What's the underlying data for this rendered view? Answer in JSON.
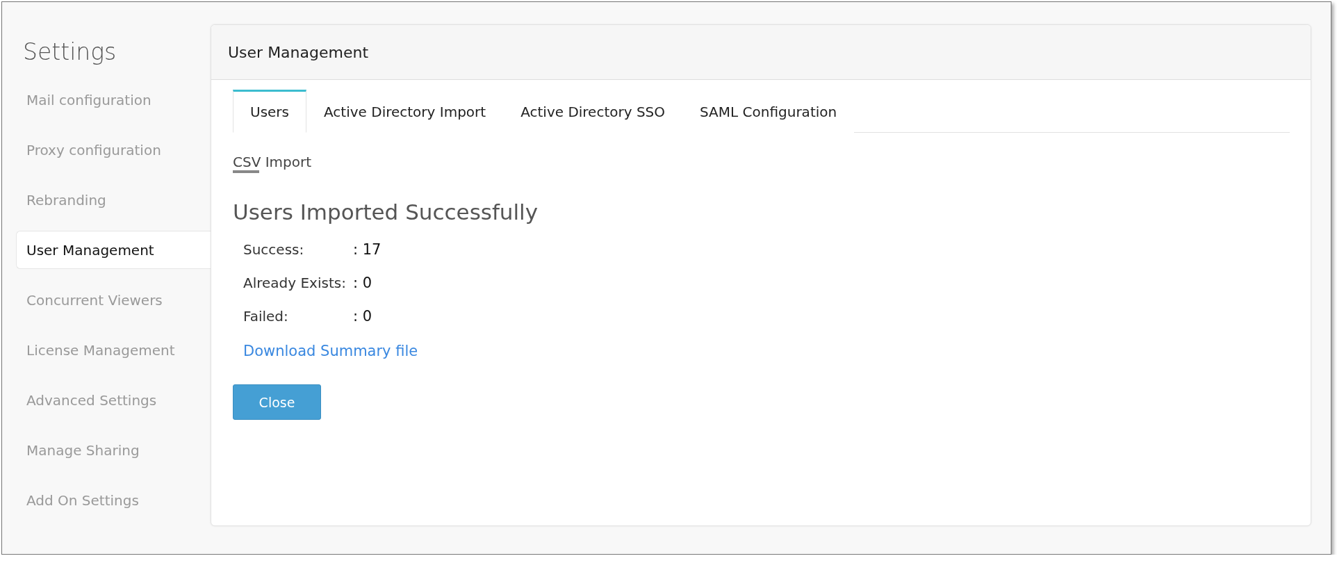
{
  "sidebar": {
    "title": "Settings",
    "items": [
      {
        "label": "Mail configuration",
        "selected": false
      },
      {
        "label": "Proxy configuration",
        "selected": false
      },
      {
        "label": "Rebranding",
        "selected": false
      },
      {
        "label": "User Management",
        "selected": true
      },
      {
        "label": "Concurrent Viewers",
        "selected": false
      },
      {
        "label": "License Management",
        "selected": false
      },
      {
        "label": "Advanced Settings",
        "selected": false
      },
      {
        "label": "Manage Sharing",
        "selected": false
      },
      {
        "label": "Add On Settings",
        "selected": false
      }
    ]
  },
  "panel": {
    "title": "User Management",
    "tabs": [
      {
        "label": "Users",
        "selected": true
      },
      {
        "label": "Active Directory Import",
        "selected": false
      },
      {
        "label": "Active Directory SSO",
        "selected": false
      },
      {
        "label": "SAML Configuration",
        "selected": false
      }
    ],
    "subtab": {
      "label": "CSV Import",
      "selected": true
    },
    "heading": "Users Imported Successfully",
    "results": [
      {
        "label": "Success:",
        "value": ": 17"
      },
      {
        "label": "Already Exists:",
        "value": ": 0"
      },
      {
        "label": "Failed:",
        "value": ": 0"
      }
    ],
    "link": "Download Summary file",
    "button": "Close"
  }
}
